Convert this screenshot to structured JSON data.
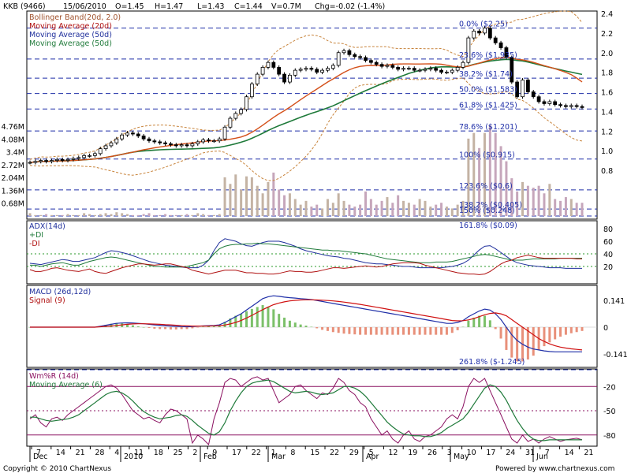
{
  "header": {
    "symbol": "KKB (9466)",
    "date": "15/06/2010",
    "open": "O=1.45",
    "high": "H=1.47",
    "low": "L=1.43",
    "close": "C=1.44",
    "volume": "V=0.7M",
    "change": "Chg=-0.02 (-1.4%)"
  },
  "colors": {
    "frame": "#000000",
    "candle_up": "#ffffff",
    "candle_down": "#000000",
    "bollinger": "#c8843c",
    "ma20": "#d4501a",
    "ma50": "#1f7a3a",
    "fib": "#1f2fa8",
    "volume_up": "#c9b9a8",
    "volume_down": "#c9a0b9",
    "adx": "#1f2f9c",
    "plus_di": "#1f7a3a",
    "minus_di": "#b01010",
    "macd": "#1f2fa8",
    "signal": "#d01010",
    "hist_pos": "#7cc06a",
    "hist_neg": "#e8907a",
    "willr": "#8a1060",
    "willr_ma": "#1f7a3a",
    "willr_band": "#8a1060"
  },
  "legend_price": [
    {
      "text": "Bollinger Band(20d, 2.0)",
      "color": "#a0522d"
    },
    {
      "text": "Moving Average (20d)",
      "color": "#b01010"
    },
    {
      "text": "Moving Average (50d)",
      "color": "#1f2f9c"
    },
    {
      "text": "Moving Average (50d)",
      "color": "#1f7a3a"
    }
  ],
  "legend_adx": [
    {
      "text": "ADX(14d)",
      "color": "#1f2f9c"
    },
    {
      "text": "+DI",
      "color": "#1f7a3a"
    },
    {
      "text": "-DI",
      "color": "#b01010"
    }
  ],
  "legend_macd": [
    {
      "text": "MACD (26d,12d)",
      "color": "#1f2f9c"
    },
    {
      "text": "Signal (9)",
      "color": "#b01010"
    }
  ],
  "legend_willr": [
    {
      "text": "Wm%R (14d)",
      "color": "#8a1060"
    },
    {
      "text": "Moving Average (6)",
      "color": "#1f7a3a"
    }
  ],
  "fib_levels": [
    {
      "label": "0.0% ($2.25)",
      "price": 2.25
    },
    {
      "label": "23.6% ($1.935)",
      "price": 1.935
    },
    {
      "label": "38.2% ($1.74)",
      "price": 1.74
    },
    {
      "label": "50.0% ($1.583)",
      "price": 1.583
    },
    {
      "label": "61.8% ($1.425)",
      "price": 1.425
    },
    {
      "label": "78.6% ($1.201)",
      "price": 1.201
    },
    {
      "label": "100% ($0.915)",
      "price": 0.915
    },
    {
      "label": "123.6% ($0.6)",
      "price": 0.6
    },
    {
      "label": "138.2% ($0.405)",
      "price": 0.405
    },
    {
      "label": "150% ($0.248)",
      "price": 0.248
    },
    {
      "label": "161.8% ($0.09)",
      "price": 0.09
    },
    {
      "label": "261.8% ($-1.245)",
      "price": -1.245
    }
  ],
  "price_ticks": [
    "2.4",
    "2.2",
    "2.0",
    "1.8",
    "1.6",
    "1.4",
    "1.2",
    "1.0",
    "0.8"
  ],
  "volume_ticks": [
    "4.76M",
    "4.08M",
    "3.4M",
    "2.72M",
    "2.04M",
    "1.36M",
    "0.68M"
  ],
  "adx_ticks": [
    "80",
    "60",
    "40",
    "20"
  ],
  "macd_ticks": [
    "0.141",
    "0",
    "-0.141"
  ],
  "willr_ticks": [
    "-20",
    "-50",
    "-80"
  ],
  "x_day_labels": [
    "7",
    "14",
    "21",
    "28",
    "4",
    "11",
    "18",
    "25",
    "2",
    "9",
    "17",
    "22",
    "1",
    "8",
    "15",
    "22",
    "29",
    "5",
    "12",
    "19",
    "26",
    "3",
    "10",
    "17",
    "24",
    "31",
    "7",
    "14",
    "21"
  ],
  "x_month_labels": [
    "Dec",
    "2010",
    "Feb",
    "Mar",
    "Apr",
    "May",
    "Jun"
  ],
  "footer": {
    "copyright": "Copyright © 2010 ChartNexus",
    "powered": "Powered by www.chartnexus.com"
  },
  "chart_data": {
    "type": "candlestick",
    "title": "KKB (9466)",
    "x_range": [
      "2009-12-01",
      "2010-06-21"
    ],
    "ylim": [
      0.6,
      2.45
    ],
    "closes": [
      0.88,
      0.89,
      0.9,
      0.89,
      0.9,
      0.91,
      0.9,
      0.91,
      0.92,
      0.93,
      0.95,
      0.95,
      0.97,
      1.02,
      1.05,
      1.08,
      1.12,
      1.16,
      1.18,
      1.17,
      1.15,
      1.12,
      1.1,
      1.09,
      1.08,
      1.07,
      1.06,
      1.05,
      1.06,
      1.05,
      1.07,
      1.09,
      1.11,
      1.1,
      1.1,
      1.12,
      1.24,
      1.33,
      1.38,
      1.42,
      1.55,
      1.68,
      1.78,
      1.85,
      1.9,
      1.85,
      1.78,
      1.7,
      1.77,
      1.82,
      1.83,
      1.84,
      1.83,
      1.8,
      1.82,
      1.84,
      1.87,
      2.0,
      2.02,
      1.98,
      1.96,
      1.95,
      1.92,
      1.9,
      1.88,
      1.86,
      1.87,
      1.85,
      1.83,
      1.84,
      1.84,
      1.82,
      1.82,
      1.83,
      1.84,
      1.82,
      1.8,
      1.8,
      1.82,
      1.85,
      1.9,
      2.15,
      2.22,
      2.2,
      2.25,
      2.15,
      2.1,
      2.05,
      1.95,
      1.7,
      1.55,
      1.72,
      1.6,
      1.55,
      1.5,
      1.48,
      1.5,
      1.47,
      1.46,
      1.45,
      1.46,
      1.45,
      1.44
    ],
    "volume_m": [
      0.15,
      0.05,
      0.05,
      0.1,
      0.05,
      0.05,
      0.05,
      0.1,
      0.05,
      0.05,
      0.15,
      0.1,
      0.05,
      0.1,
      0.15,
      0.1,
      0.2,
      0.15,
      0.1,
      0.05,
      0.05,
      0.1,
      0.15,
      0.05,
      0.05,
      0.1,
      0.05,
      0.05,
      0.05,
      0.1,
      0.05,
      0.15,
      0.1,
      0.05,
      0.05,
      0.1,
      2.05,
      1.7,
      2.2,
      1.4,
      2.1,
      2.05,
      1.6,
      1.2,
      1.8,
      2.3,
      1.4,
      1.1,
      1.2,
      0.9,
      0.6,
      0.8,
      0.5,
      0.6,
      0.4,
      0.9,
      0.7,
      1.2,
      0.8,
      0.6,
      0.5,
      0.6,
      1.3,
      0.9,
      0.6,
      0.8,
      1.0,
      0.7,
      1.1,
      0.8,
      0.7,
      0.6,
      0.9,
      0.8,
      0.5,
      0.6,
      0.7,
      0.5,
      0.4,
      0.6,
      0.8,
      4.1,
      4.4,
      3.6,
      4.4,
      4.8,
      4.4,
      3.7,
      2.9,
      2.0,
      1.3,
      1.8,
      1.6,
      1.5,
      1.6,
      1.2,
      1.7,
      0.9,
      0.8,
      1.0,
      0.9,
      0.7,
      0.7
    ],
    "adx": [
      25,
      24,
      23,
      25,
      27,
      29,
      31,
      30,
      28,
      28,
      30,
      32,
      34,
      38,
      42,
      45,
      44,
      42,
      40,
      37,
      34,
      31,
      28,
      26,
      24,
      22,
      21,
      20,
      19,
      18,
      18,
      18,
      22,
      30,
      45,
      58,
      64,
      62,
      60,
      56,
      53,
      52,
      55,
      58,
      60,
      60,
      60,
      58,
      55,
      52,
      48,
      45,
      43,
      41,
      39,
      37,
      36,
      35,
      33,
      32,
      30,
      28,
      26,
      25,
      24,
      24,
      23,
      22,
      21,
      20,
      20,
      19,
      18,
      18,
      18,
      18,
      18,
      19,
      20,
      22,
      25,
      30,
      38,
      46,
      52,
      53,
      48,
      42,
      36,
      30,
      26,
      24,
      22,
      21,
      20,
      19,
      18,
      18,
      18,
      17,
      17,
      17,
      17
    ],
    "plus_di": [
      22,
      22,
      20,
      22,
      24,
      25,
      26,
      24,
      22,
      22,
      25,
      28,
      30,
      32,
      34,
      35,
      34,
      32,
      30,
      28,
      26,
      24,
      22,
      20,
      20,
      19,
      19,
      19,
      19,
      20,
      22,
      24,
      26,
      30,
      40,
      48,
      52,
      54,
      55,
      55,
      56,
      56,
      57,
      56,
      56,
      55,
      54,
      53,
      52,
      51,
      50,
      49,
      48,
      47,
      46,
      46,
      45,
      45,
      44,
      43,
      42,
      41,
      40,
      38,
      36,
      34,
      32,
      31,
      30,
      29,
      28,
      27,
      26,
      26,
      26,
      27,
      27,
      27,
      28,
      30,
      32,
      34,
      36,
      38,
      39,
      38,
      36,
      34,
      32,
      30,
      30,
      30,
      31,
      32,
      32,
      32,
      32,
      32,
      33,
      33,
      33,
      33,
      33
    ],
    "minus_di": [
      15,
      12,
      12,
      14,
      17,
      18,
      16,
      14,
      13,
      12,
      14,
      16,
      12,
      10,
      9,
      12,
      15,
      18,
      20,
      22,
      24,
      24,
      23,
      22,
      23,
      24,
      24,
      22,
      20,
      18,
      14,
      12,
      10,
      8,
      10,
      12,
      14,
      14,
      14,
      12,
      10,
      10,
      9,
      9,
      8,
      8,
      9,
      11,
      13,
      12,
      12,
      11,
      11,
      12,
      14,
      16,
      18,
      18,
      17,
      18,
      19,
      20,
      21,
      20,
      19,
      20,
      22,
      24,
      25,
      26,
      26,
      26,
      25,
      22,
      20,
      18,
      16,
      14,
      12,
      10,
      9,
      8,
      8,
      7,
      8,
      12,
      18,
      24,
      28,
      30,
      34,
      36,
      38,
      36,
      34,
      33,
      33,
      33,
      33,
      33,
      33,
      32,
      32
    ],
    "macd": [
      0,
      0,
      0,
      0,
      0,
      0,
      0,
      0,
      0,
      0,
      0,
      0,
      0,
      0.005,
      0.01,
      0.015,
      0.02,
      0.022,
      0.023,
      0.022,
      0.02,
      0.018,
      0.015,
      0.012,
      0.01,
      0.008,
      0.006,
      0.004,
      0.003,
      0.002,
      0.003,
      0.005,
      0.007,
      0.008,
      0.009,
      0.012,
      0.025,
      0.04,
      0.055,
      0.07,
      0.09,
      0.11,
      0.13,
      0.15,
      0.16,
      0.165,
      0.162,
      0.158,
      0.155,
      0.153,
      0.15,
      0.148,
      0.145,
      0.14,
      0.135,
      0.13,
      0.125,
      0.12,
      0.115,
      0.11,
      0.105,
      0.1,
      0.095,
      0.09,
      0.085,
      0.08,
      0.075,
      0.07,
      0.065,
      0.06,
      0.055,
      0.05,
      0.045,
      0.04,
      0.035,
      0.03,
      0.025,
      0.02,
      0.02,
      0.025,
      0.035,
      0.055,
      0.07,
      0.085,
      0.095,
      0.09,
      0.07,
      0.04,
      0.0,
      -0.04,
      -0.07,
      -0.09,
      -0.105,
      -0.115,
      -0.12,
      -0.125,
      -0.128,
      -0.13,
      -0.13,
      -0.13,
      -0.13,
      -0.13,
      -0.13
    ],
    "signal": [
      0,
      0,
      0,
      0,
      0,
      0,
      0,
      0,
      0,
      0,
      0,
      0,
      0,
      0.002,
      0.004,
      0.006,
      0.009,
      0.012,
      0.015,
      0.017,
      0.018,
      0.018,
      0.017,
      0.016,
      0.015,
      0.013,
      0.012,
      0.01,
      0.008,
      0.007,
      0.006,
      0.006,
      0.006,
      0.006,
      0.007,
      0.008,
      0.011,
      0.017,
      0.025,
      0.035,
      0.048,
      0.062,
      0.077,
      0.092,
      0.106,
      0.118,
      0.127,
      0.133,
      0.138,
      0.141,
      0.143,
      0.144,
      0.144,
      0.143,
      0.142,
      0.14,
      0.138,
      0.135,
      0.132,
      0.128,
      0.124,
      0.12,
      0.115,
      0.11,
      0.105,
      0.1,
      0.095,
      0.09,
      0.085,
      0.08,
      0.075,
      0.07,
      0.065,
      0.06,
      0.055,
      0.05,
      0.045,
      0.04,
      0.035,
      0.033,
      0.034,
      0.038,
      0.045,
      0.055,
      0.065,
      0.072,
      0.075,
      0.07,
      0.06,
      0.04,
      0.02,
      0.0,
      -0.02,
      -0.04,
      -0.06,
      -0.075,
      -0.088,
      -0.098,
      -0.105,
      -0.11,
      -0.114,
      -0.117,
      -0.12
    ],
    "willr": [
      -60,
      -55,
      -65,
      -70,
      -60,
      -58,
      -62,
      -55,
      -50,
      -45,
      -40,
      -35,
      -30,
      -25,
      -20,
      -18,
      -22,
      -30,
      -40,
      -50,
      -55,
      -60,
      -58,
      -62,
      -65,
      -55,
      -48,
      -50,
      -55,
      -60,
      -90,
      -80,
      -85,
      -92,
      -60,
      -40,
      -15,
      -10,
      -12,
      -20,
      -15,
      -10,
      -8,
      -12,
      -10,
      -25,
      -40,
      -35,
      -30,
      -20,
      -18,
      -25,
      -30,
      -35,
      -28,
      -30,
      -22,
      -10,
      -15,
      -25,
      -30,
      -40,
      -45,
      -60,
      -70,
      -80,
      -75,
      -85,
      -90,
      -80,
      -75,
      -85,
      -88,
      -82,
      -80,
      -75,
      -70,
      -60,
      -55,
      -60,
      -45,
      -20,
      -10,
      -15,
      -10,
      -25,
      -40,
      -55,
      -70,
      -85,
      -90,
      -80,
      -88,
      -85,
      -90,
      -85,
      -82,
      -85,
      -88,
      -86,
      -85,
      -84,
      -86
    ],
    "willr_ma": [
      -58,
      -58,
      -60,
      -62,
      -63,
      -62,
      -61,
      -60,
      -58,
      -55,
      -50,
      -45,
      -40,
      -35,
      -30,
      -27,
      -26,
      -28,
      -32,
      -38,
      -45,
      -51,
      -55,
      -58,
      -60,
      -59,
      -58,
      -56,
      -55,
      -57,
      -62,
      -68,
      -73,
      -78,
      -80,
      -76,
      -65,
      -50,
      -38,
      -28,
      -20,
      -16,
      -14,
      -13,
      -12,
      -14,
      -18,
      -22,
      -26,
      -28,
      -27,
      -26,
      -27,
      -29,
      -30,
      -29,
      -28,
      -24,
      -20,
      -20,
      -22,
      -26,
      -32,
      -40,
      -48,
      -56,
      -64,
      -70,
      -75,
      -79,
      -80,
      -81,
      -81,
      -82,
      -82,
      -80,
      -77,
      -72,
      -68,
      -64,
      -60,
      -52,
      -42,
      -32,
      -22,
      -18,
      -20,
      -27,
      -37,
      -50,
      -62,
      -72,
      -80,
      -85,
      -87,
      -87,
      -86,
      -86,
      -86,
      -86,
      -86,
      -86,
      -86
    ]
  }
}
